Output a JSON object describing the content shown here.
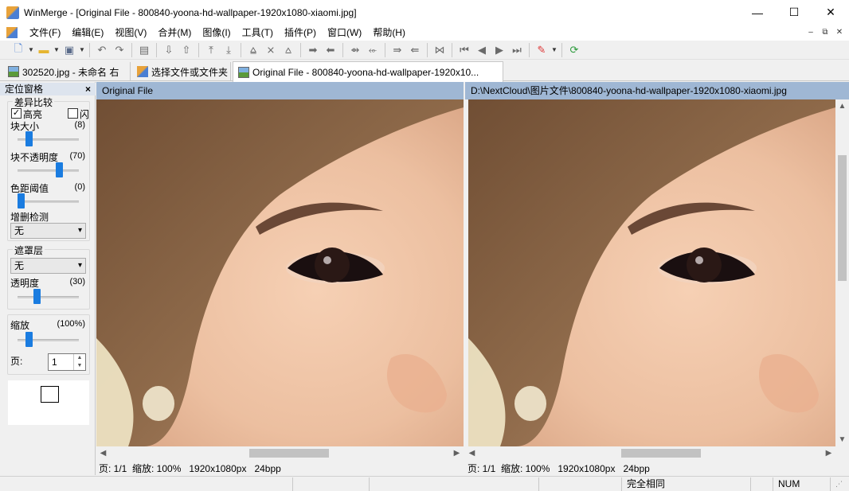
{
  "window": {
    "title": "WinMerge - [Original File - 800840-yoona-hd-wallpaper-1920x1080-xiaomi.jpg]",
    "minimize": "—",
    "maximize": "☐",
    "close": "✕"
  },
  "menu": {
    "items": [
      "文件(F)",
      "编辑(E)",
      "视图(V)",
      "合并(M)",
      "图像(I)",
      "工具(T)",
      "插件(P)",
      "窗口(W)",
      "帮助(H)"
    ],
    "mdi_minimize": "–",
    "mdi_restore": "⧉",
    "mdi_close": "✕"
  },
  "tabs": [
    {
      "label": "302520.jpg - 未命名 右",
      "icon": "image-icon"
    },
    {
      "label": "选择文件或文件夹",
      "icon": "winmerge-icon"
    },
    {
      "label": "Original File - 800840-yoona-hd-wallpaper-1920x10...",
      "icon": "image-icon"
    }
  ],
  "location_pane": {
    "title": "定位窗格",
    "close": "×",
    "diff_group": {
      "title": "差异比较",
      "highlight_label": "高亮",
      "highlight_checked": true,
      "flash_label": "闪",
      "flash_checked": false,
      "block_size_label": "块大小",
      "block_size_value": "(8)",
      "block_size_level": 0.15,
      "block_opacity_label": "块不透明度",
      "block_opacity_value": "(70)",
      "block_opacity_level": 0.7,
      "color_threshold_label": "色距阈值",
      "color_threshold_value": "(0)",
      "color_threshold_level": 0.0,
      "insertion_detect_label": "增删检测",
      "insertion_detect_selected": "无"
    },
    "overlay_group": {
      "title": "遮罩层",
      "selected": "无",
      "opacity_label": "透明度",
      "opacity_value": "(30)",
      "opacity_level": 0.3
    },
    "zoom_group": {
      "zoom_label": "缩放",
      "zoom_value": "(100%)",
      "zoom_level": 0.15,
      "page_label": "页:",
      "page_value": "1"
    }
  },
  "left_image": {
    "header": "Original File",
    "status": "页: 1/1  缩放: 100%   1920x1080px   24bpp"
  },
  "right_image": {
    "header": "D:\\NextCloud\\图片文件\\800840-yoona-hd-wallpaper-1920x1080-xiaomi.jpg",
    "status": "页: 1/1  缩放: 100%   1920x1080px   24bpp"
  },
  "statusbar": {
    "compare_result": "完全相同",
    "num": "NUM"
  },
  "colors": {
    "header_bg": "#9fb7d4",
    "slider_thumb": "#1a7ce0",
    "pane_header_bg": "#dde4ee"
  }
}
